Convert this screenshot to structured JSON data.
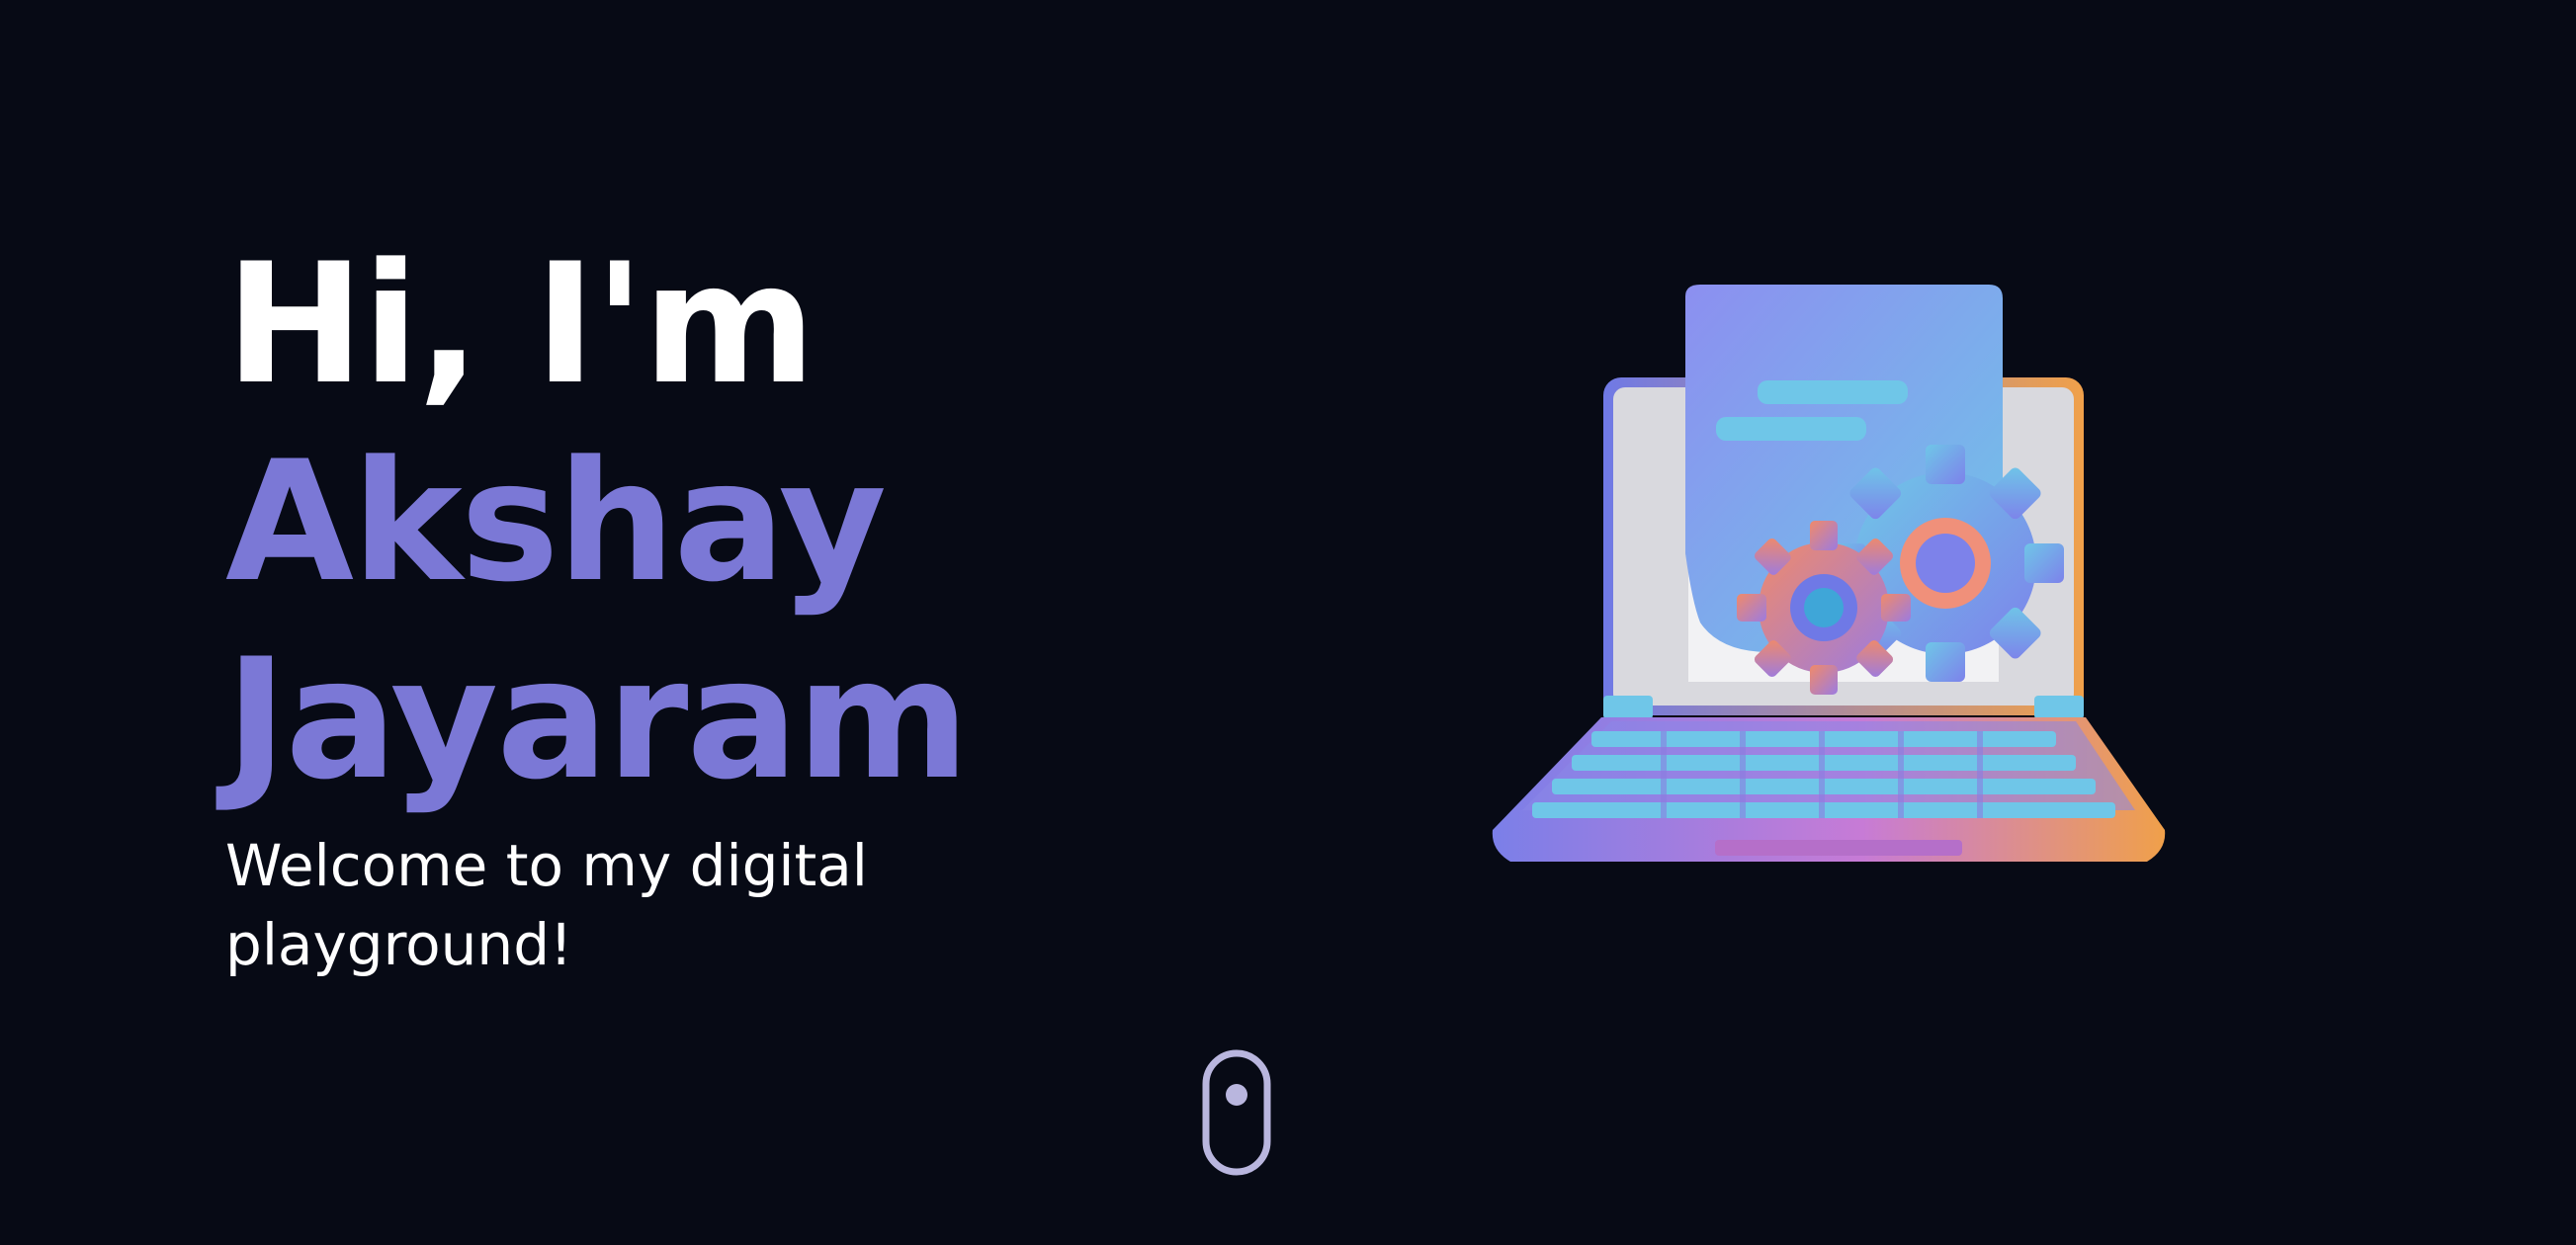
{
  "hero": {
    "greeting": "Hi, I'm",
    "name_first": "Akshay",
    "name_last": "Jayaram",
    "tagline": "Welcome to my digital playground!"
  },
  "illustration": {
    "icon": "laptop-with-gears-icon"
  },
  "scroll": {
    "icon": "mouse-scroll-icon"
  },
  "colors": {
    "background": "#070a15",
    "accent": "#7b78d6",
    "text": "#ffffff"
  }
}
